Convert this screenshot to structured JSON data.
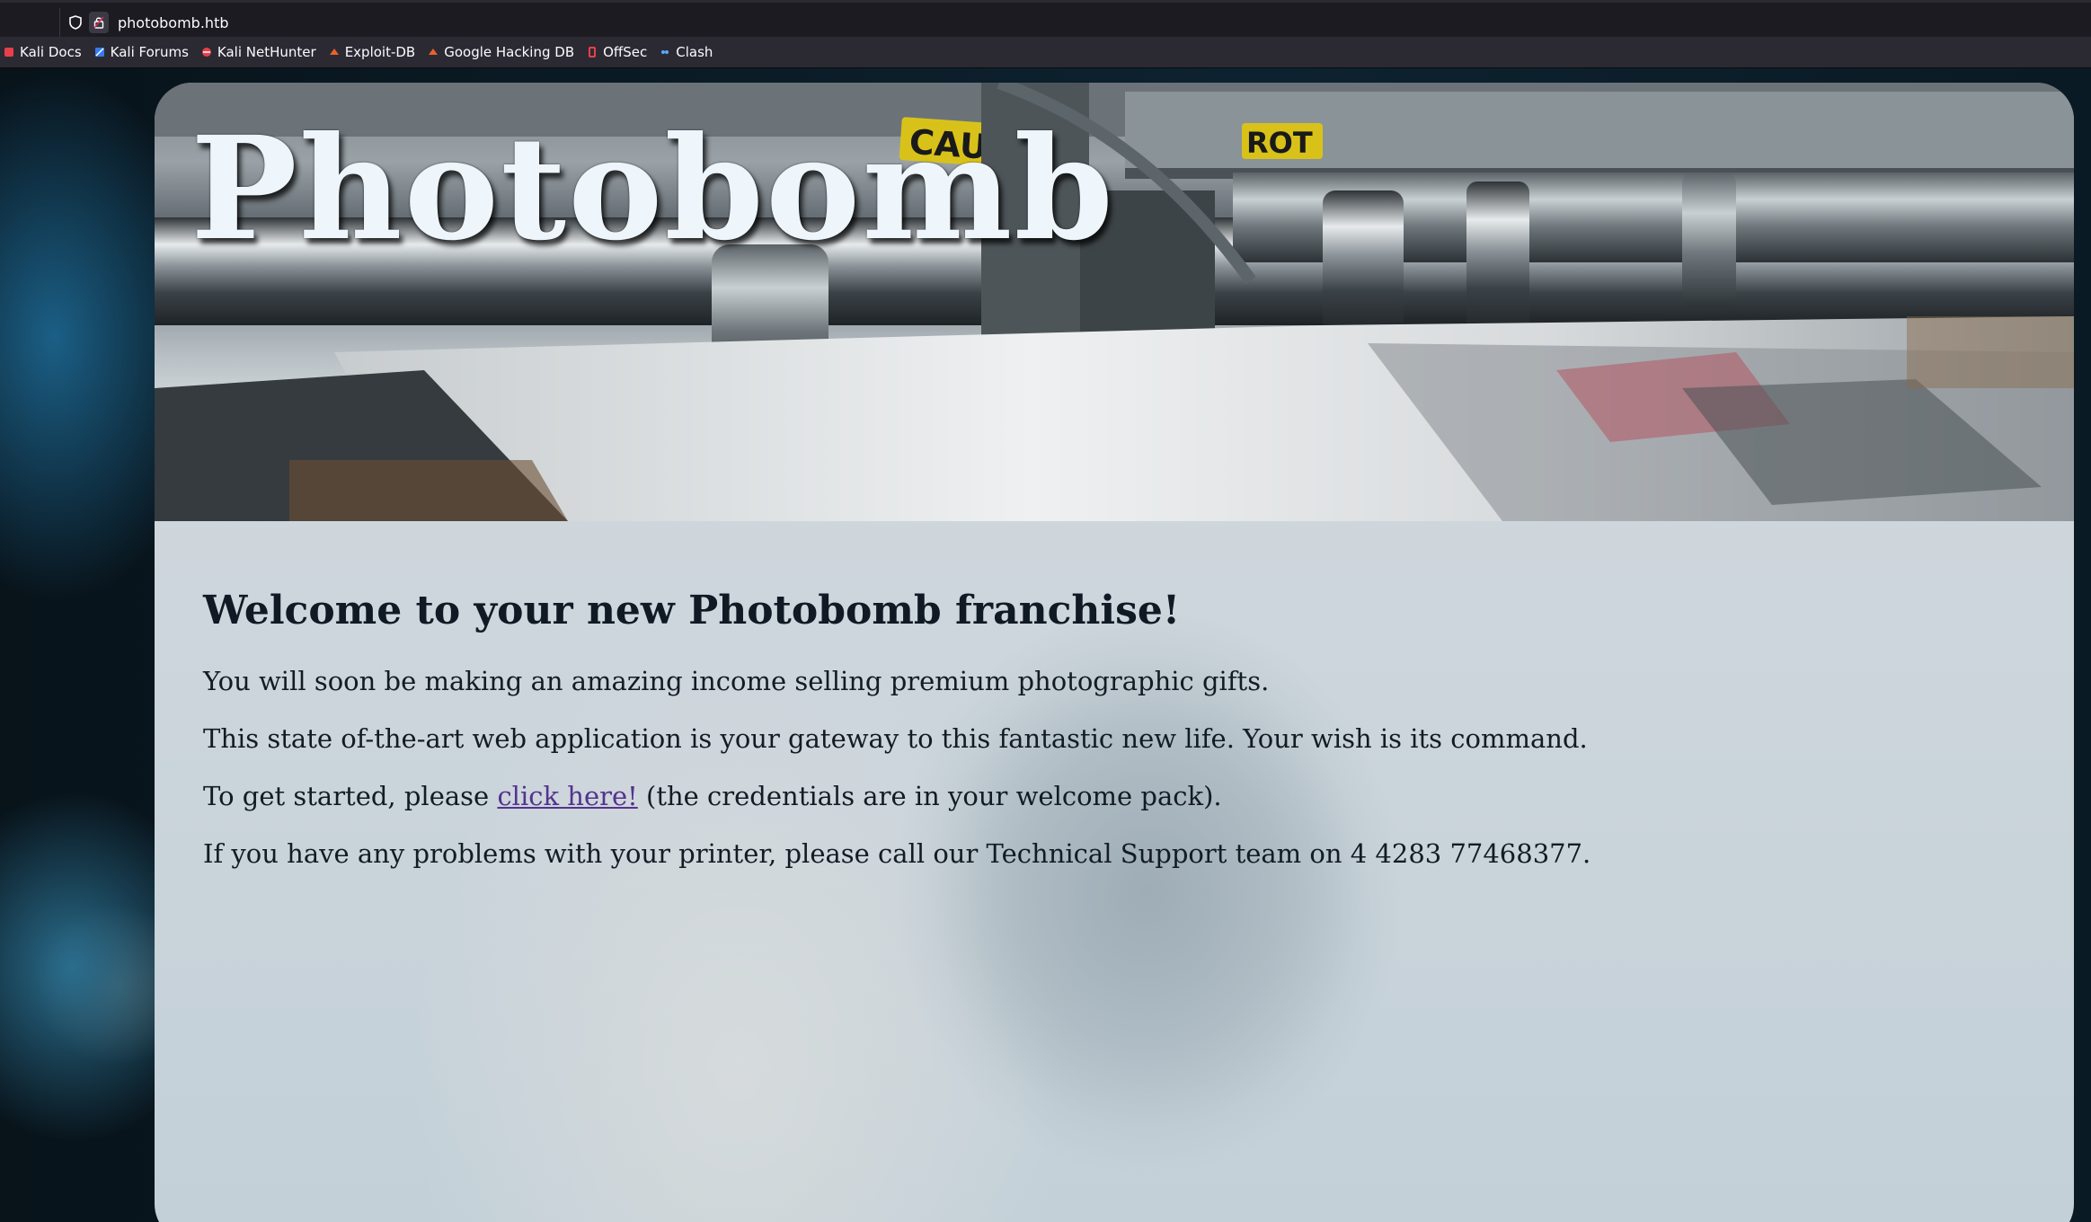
{
  "browser": {
    "url": "photobomb.htb",
    "bookmarks": [
      {
        "label": "Kali Docs",
        "icon": "kali-docs-icon",
        "color": "#e8404a"
      },
      {
        "label": "Kali Forums",
        "icon": "kali-forums-icon",
        "color": "#367bf0"
      },
      {
        "label": "Kali NetHunter",
        "icon": "kali-nethunter-icon",
        "color": "#e8404a"
      },
      {
        "label": "Exploit-DB",
        "icon": "exploit-db-icon",
        "color": "#e8612c"
      },
      {
        "label": "Google Hacking DB",
        "icon": "google-hacking-db-icon",
        "color": "#e8612c"
      },
      {
        "label": "OffSec",
        "icon": "offsec-icon",
        "color": "#e8404a"
      },
      {
        "label": "Clash",
        "icon": "clash-icon",
        "color": "#5aa8ff"
      }
    ]
  },
  "page": {
    "title": "Photobomb",
    "heading": "Welcome to your new Photobomb franchise!",
    "para1": "You will soon be making an amazing income selling premium photographic gifts.",
    "para2": "This state of-the-art web application is your gateway to this fantastic new life. Your wish is its command.",
    "para3_before": "To get started, please ",
    "para3_link": "click here!",
    "para3_after": " (the credentials are in your welcome pack).",
    "para4": "If you have any problems with your printer, please call our Technical Support team on 4 4283 77468377.",
    "link_color": "#55338f"
  }
}
